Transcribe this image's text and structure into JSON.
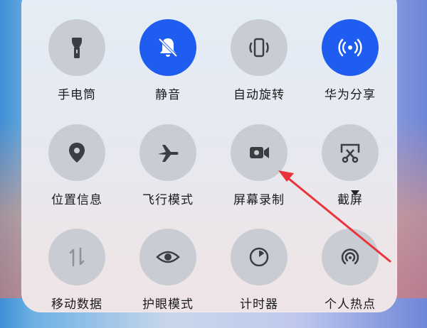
{
  "tiles": [
    {
      "label": "手电筒",
      "icon": "flashlight-icon",
      "active": false
    },
    {
      "label": "静音",
      "icon": "bell-off-icon",
      "active": true
    },
    {
      "label": "自动旋转",
      "icon": "auto-rotate-icon",
      "active": false
    },
    {
      "label": "华为分享",
      "icon": "huawei-share-icon",
      "active": true
    },
    {
      "label": "位置信息",
      "icon": "location-icon",
      "active": false
    },
    {
      "label": "飞行模式",
      "icon": "airplane-icon",
      "active": false
    },
    {
      "label": "屏幕录制",
      "icon": "screen-record-icon",
      "active": false
    },
    {
      "label": "截屏",
      "icon": "screenshot-icon",
      "active": false
    },
    {
      "label": "移动数据",
      "icon": "mobile-data-icon",
      "active": false
    },
    {
      "label": "护眼模式",
      "icon": "eye-icon",
      "active": false
    },
    {
      "label": "计时器",
      "icon": "timer-icon",
      "active": false
    },
    {
      "label": "个人热点",
      "icon": "hotspot-icon",
      "active": false
    }
  ],
  "colors": {
    "active": "#1f5cf0",
    "inactive": "#c9cdd3",
    "annotation_arrow": "#e8343a"
  }
}
